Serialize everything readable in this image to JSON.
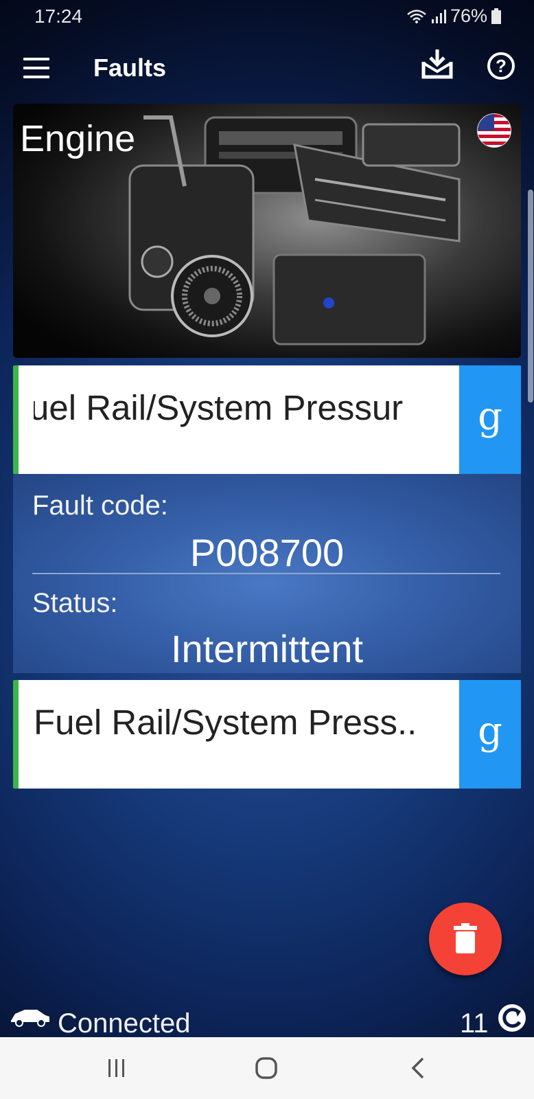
{
  "status_bar": {
    "time": "17:24",
    "battery": "76%"
  },
  "app_bar": {
    "title": "Faults"
  },
  "engine_card": {
    "title": "Engine"
  },
  "faults": [
    {
      "description": "uel Rail/System Pressur",
      "google_label": "g"
    },
    {
      "description": "Fuel Rail/System Press..",
      "google_label": "g"
    }
  ],
  "details": {
    "fault_code_label": "Fault code:",
    "fault_code": "P008700",
    "status_label": "Status:",
    "status": "Intermittent"
  },
  "bottom_bar": {
    "connection": "Connected",
    "count": "11"
  },
  "colors": {
    "accent_blue": "#2196f3",
    "fab_red": "#f44336",
    "row_green": "#3db54a"
  }
}
